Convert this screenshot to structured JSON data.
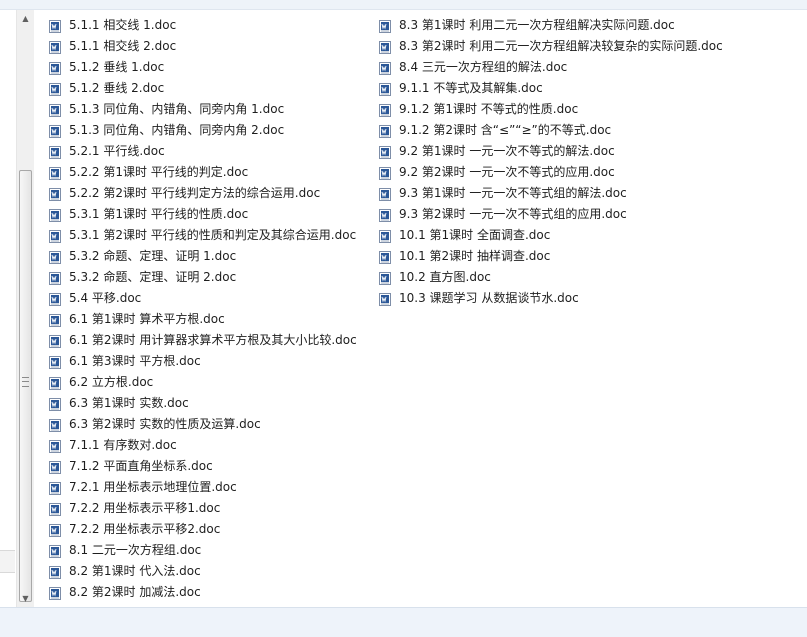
{
  "file_list": {
    "left_column": [
      "5.1.1 相交线 1.doc",
      "5.1.1 相交线 2.doc",
      "5.1.2 垂线 1.doc",
      "5.1.2 垂线 2.doc",
      "5.1.3 同位角、内错角、同旁内角 1.doc",
      "5.1.3 同位角、内错角、同旁内角 2.doc",
      "5.2.1 平行线.doc",
      "5.2.2 第1课时 平行线的判定.doc",
      "5.2.2 第2课时 平行线判定方法的综合运用.doc",
      "5.3.1 第1课时 平行线的性质.doc",
      "5.3.1 第2课时 平行线的性质和判定及其综合运用.doc",
      "5.3.2 命题、定理、证明 1.doc",
      "5.3.2 命题、定理、证明 2.doc",
      "5.4 平移.doc",
      "6.1 第1课时 算术平方根.doc",
      "6.1 第2课时  用计算器求算术平方根及其大小比较.doc",
      "6.1 第3课时 平方根.doc",
      "6.2 立方根.doc",
      "6.3 第1课时 实数.doc",
      "6.3 第2课时  实数的性质及运算.doc",
      "7.1.1 有序数对.doc",
      "7.1.2 平面直角坐标系.doc",
      "7.2.1 用坐标表示地理位置.doc",
      "7.2.2 用坐标表示平移1.doc",
      "7.2.2 用坐标表示平移2.doc",
      "8.1 二元一次方程组.doc",
      "8.2 第1课时 代入法.doc",
      "8.2 第2课时 加减法.doc"
    ],
    "right_column": [
      "8.3 第1课时 利用二元一次方程组解决实际问题.doc",
      "8.3 第2课时 利用二元一次方程组解决较复杂的实际问题.doc",
      "8.4  三元一次方程组的解法.doc",
      "9.1.1 不等式及其解集.doc",
      "9.1.2 第1课时 不等式的性质.doc",
      "9.1.2 第2课时 含“≤”“≥”的不等式.doc",
      "9.2 第1课时 一元一次不等式的解法.doc",
      "9.2 第2课时 一元一次不等式的应用.doc",
      "9.3 第1课时 一元一次不等式组的解法.doc",
      "9.3 第2课时 一元一次不等式组的应用.doc",
      "10.1 第1课时 全面调查.doc",
      "10.1 第2课时 抽样调查.doc",
      "10.2 直方图.doc",
      "10.3 课题学习  从数据谈节水.doc"
    ]
  },
  "icons": {
    "file": "word-document-icon",
    "scroll_up": "scroll-up-arrow-icon",
    "scroll_down": "scroll-down-arrow-icon"
  },
  "colors": {
    "text": "#1e1e1e",
    "icon_blue": "#2b5797",
    "chrome_bg": "#eef3fa"
  }
}
